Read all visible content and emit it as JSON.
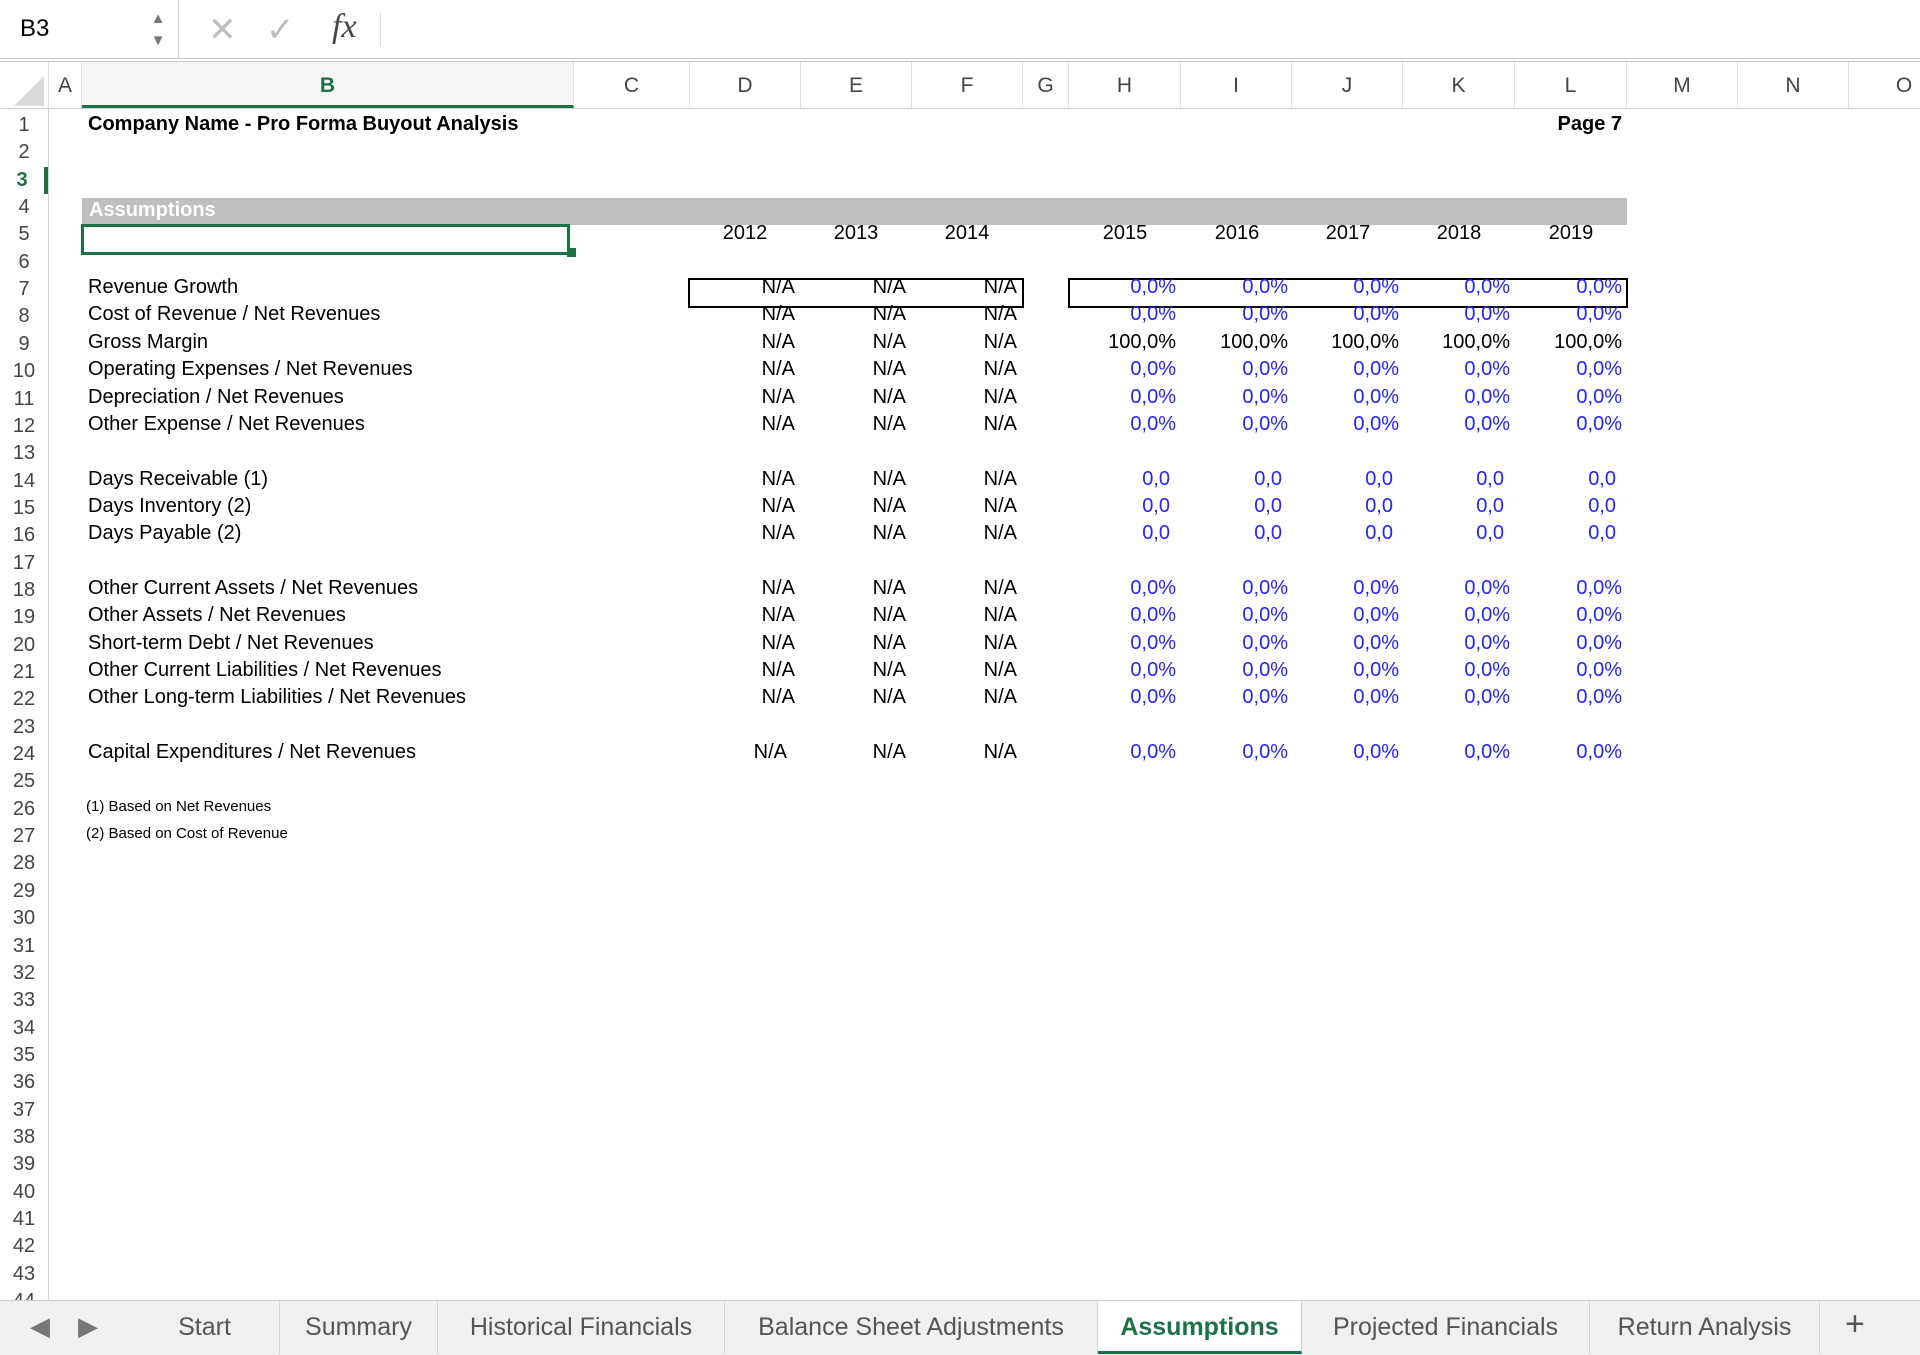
{
  "formula_bar": {
    "name_box": "B3",
    "cancel_icon": "✕",
    "enter_icon": "✓",
    "fx_label": "fx",
    "formula": ""
  },
  "columns": [
    "A",
    "B",
    "C",
    "D",
    "E",
    "F",
    "G",
    "H",
    "I",
    "J",
    "K",
    "L",
    "M",
    "N",
    "O"
  ],
  "active_column": "B",
  "active_row": 3,
  "rows": [
    1,
    2,
    3,
    4,
    5,
    6,
    7,
    8,
    9,
    10,
    11,
    12,
    13,
    14,
    15,
    16,
    17,
    18,
    19,
    20,
    21,
    22,
    23,
    24,
    25,
    26,
    27,
    28,
    29,
    30,
    31,
    32,
    33,
    34,
    35,
    36,
    37,
    38,
    39,
    40,
    41,
    42,
    43,
    44
  ],
  "sheet": {
    "title": "Company Name - Pro Forma Buyout Analysis",
    "page": "Page 7",
    "section": "Assumptions",
    "historical_years": [
      "2012",
      "2013",
      "2014"
    ],
    "projected_years": [
      "2015",
      "2016",
      "2017",
      "2018",
      "2019"
    ],
    "line_items": [
      {
        "label": "Revenue Growth",
        "hist": [
          "N/A",
          "N/A",
          "N/A"
        ],
        "proj": [
          "0,0%",
          "0,0%",
          "0,0%",
          "0,0%",
          "0,0%"
        ],
        "blue": true
      },
      {
        "label": "Cost of Revenue / Net Revenues",
        "hist": [
          "N/A",
          "N/A",
          "N/A"
        ],
        "proj": [
          "0,0%",
          "0,0%",
          "0,0%",
          "0,0%",
          "0,0%"
        ],
        "blue": true
      },
      {
        "label": "Gross Margin",
        "hist": [
          "N/A",
          "N/A",
          "N/A"
        ],
        "proj": [
          "100,0%",
          "100,0%",
          "100,0%",
          "100,0%",
          "100,0%"
        ],
        "blue": false
      },
      {
        "label": "Operating Expenses / Net Revenues",
        "hist": [
          "N/A",
          "N/A",
          "N/A"
        ],
        "proj": [
          "0,0%",
          "0,0%",
          "0,0%",
          "0,0%",
          "0,0%"
        ],
        "blue": true
      },
      {
        "label": "Depreciation / Net Revenues",
        "hist": [
          "N/A",
          "N/A",
          "N/A"
        ],
        "proj": [
          "0,0%",
          "0,0%",
          "0,0%",
          "0,0%",
          "0,0%"
        ],
        "blue": true
      },
      {
        "label": "Other Expense / Net Revenues",
        "hist": [
          "N/A",
          "N/A",
          "N/A"
        ],
        "proj": [
          "0,0%",
          "0,0%",
          "0,0%",
          "0,0%",
          "0,0%"
        ],
        "blue": true
      },
      {
        "label": "Days Receivable (1)",
        "hist": [
          "N/A",
          "N/A",
          "N/A"
        ],
        "proj": [
          "0,0",
          "0,0",
          "0,0",
          "0,0",
          "0,0"
        ],
        "blue": true
      },
      {
        "label": "Days Inventory (2)",
        "hist": [
          "N/A",
          "N/A",
          "N/A"
        ],
        "proj": [
          "0,0",
          "0,0",
          "0,0",
          "0,0",
          "0,0"
        ],
        "blue": true
      },
      {
        "label": "Days Payable (2)",
        "hist": [
          "N/A",
          "N/A",
          "N/A"
        ],
        "proj": [
          "0,0",
          "0,0",
          "0,0",
          "0,0",
          "0,0"
        ],
        "blue": true
      },
      {
        "label": "Other Current Assets / Net Revenues",
        "hist": [
          "N/A",
          "N/A",
          "N/A"
        ],
        "proj": [
          "0,0%",
          "0,0%",
          "0,0%",
          "0,0%",
          "0,0%"
        ],
        "blue": true
      },
      {
        "label": "Other Assets / Net Revenues",
        "hist": [
          "N/A",
          "N/A",
          "N/A"
        ],
        "proj": [
          "0,0%",
          "0,0%",
          "0,0%",
          "0,0%",
          "0,0%"
        ],
        "blue": true
      },
      {
        "label": "Short-term Debt / Net Revenues",
        "hist": [
          "N/A",
          "N/A",
          "N/A"
        ],
        "proj": [
          "0,0%",
          "0,0%",
          "0,0%",
          "0,0%",
          "0,0%"
        ],
        "blue": true
      },
      {
        "label": "Other Current Liabilities / Net Revenues",
        "hist": [
          "N/A",
          "N/A",
          "N/A"
        ],
        "proj": [
          "0,0%",
          "0,0%",
          "0,0%",
          "0,0%",
          "0,0%"
        ],
        "blue": true
      },
      {
        "label": "Other Long-term Liabilities / Net Revenues",
        "hist": [
          "N/A",
          "N/A",
          "N/A"
        ],
        "proj": [
          "0,0%",
          "0,0%",
          "0,0%",
          "0,0%",
          "0,0%"
        ],
        "blue": true
      },
      {
        "label": "Capital Expenditures / Net Revenues",
        "hist": [
          "N/A",
          "N/A",
          "N/A"
        ],
        "proj": [
          "0,0%",
          "0,0%",
          "0,0%",
          "0,0%",
          "0,0%"
        ],
        "blue": true
      }
    ],
    "notes": [
      "(1) Based on Net Revenues",
      "(2) Based on Cost of Revenue"
    ]
  },
  "tabs": {
    "prev_icon": "◀",
    "next_icon": "▶",
    "items": [
      "Start",
      "Summary",
      "Historical Financials",
      "Balance Sheet Adjustments",
      "Assumptions",
      "Projected Financials",
      "Return Analysis"
    ],
    "active": "Assumptions",
    "add_icon": "+"
  },
  "colors": {
    "accent": "#1e7145",
    "input_blue": "#2323ff",
    "band_gray": "#bfbfbf"
  }
}
